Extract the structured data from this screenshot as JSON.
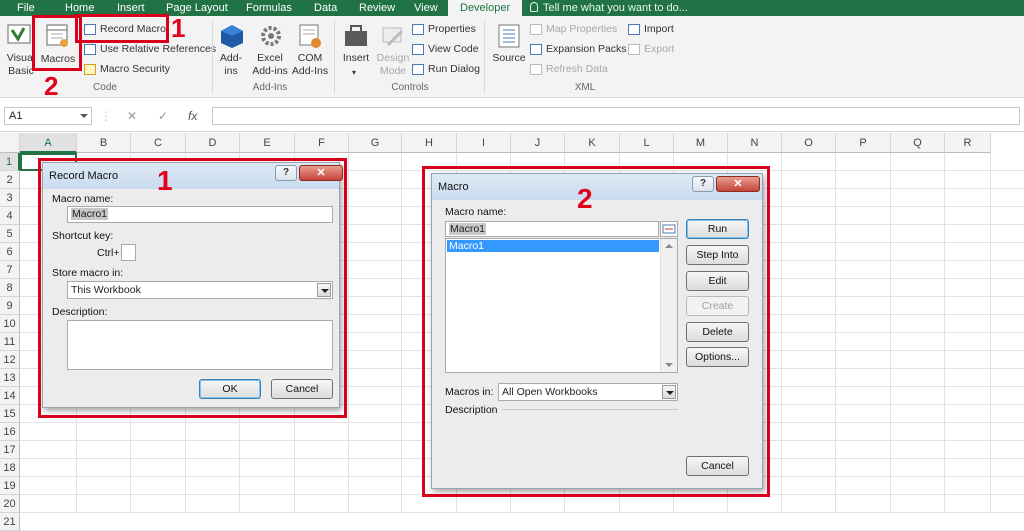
{
  "tabs": [
    "File",
    "Home",
    "Insert",
    "Page Layout",
    "Formulas",
    "Data",
    "Review",
    "View",
    "Developer"
  ],
  "tell_me": "Tell me what you want to do...",
  "ribbon": {
    "code": {
      "visual_basic": "Visual\nBasic",
      "macros": "Macros",
      "record_macro": "Record Macro",
      "use_relative": "Use Relative References",
      "macro_security": "Macro Security",
      "label": "Code"
    },
    "addins": {
      "addins": "Add-\nins",
      "excel_addins": "Excel\nAdd-ins",
      "com_addins": "COM\nAdd-Ins",
      "label": "Add-Ins"
    },
    "controls": {
      "insert": "Insert",
      "design_mode": "Design\nMode",
      "properties": "Properties",
      "view_code": "View Code",
      "run_dialog": "Run Dialog",
      "label": "Controls"
    },
    "xml": {
      "source": "Source",
      "map_properties": "Map Properties",
      "expansion_packs": "Expansion Packs",
      "refresh_data": "Refresh Data",
      "import": "Import",
      "export": "Export",
      "label": "XML"
    }
  },
  "annotations": {
    "one": "1",
    "two": "2"
  },
  "formula_bar": {
    "name_box": "A1",
    "fx": "fx",
    "cancel": "✕",
    "enter": "✓",
    "value": ""
  },
  "columns": [
    "A",
    "B",
    "C",
    "D",
    "E",
    "F",
    "G",
    "H",
    "I",
    "J",
    "K",
    "L",
    "M",
    "N",
    "O",
    "P",
    "Q",
    "R"
  ],
  "rows": [
    "1",
    "2",
    "3",
    "4",
    "5",
    "6",
    "7",
    "8",
    "9",
    "10",
    "11",
    "12",
    "13",
    "14",
    "15",
    "16",
    "17",
    "18",
    "19",
    "20",
    "21"
  ],
  "record_dialog": {
    "title": "Record Macro",
    "help": "?",
    "close": "✕",
    "macro_name_label": "Macro name:",
    "macro_name_value": "Macro1",
    "shortcut_label": "Shortcut key:",
    "ctrl_label": "Ctrl+",
    "store_label": "Store macro in:",
    "store_value": "This Workbook",
    "description_label": "Description:",
    "ok": "OK",
    "cancel": "Cancel"
  },
  "macro_dialog": {
    "title": "Macro",
    "help": "?",
    "close": "✕",
    "macro_name_label": "Macro name:",
    "macro_name_value": "Macro1",
    "list_items": [
      "Macro1"
    ],
    "run": "Run",
    "step_into": "Step Into",
    "edit": "Edit",
    "create": "Create",
    "delete": "Delete",
    "options": "Options...",
    "macros_in_label": "Macros in:",
    "macros_in_value": "All Open Workbooks",
    "description_label": "Description",
    "cancel": "Cancel"
  }
}
